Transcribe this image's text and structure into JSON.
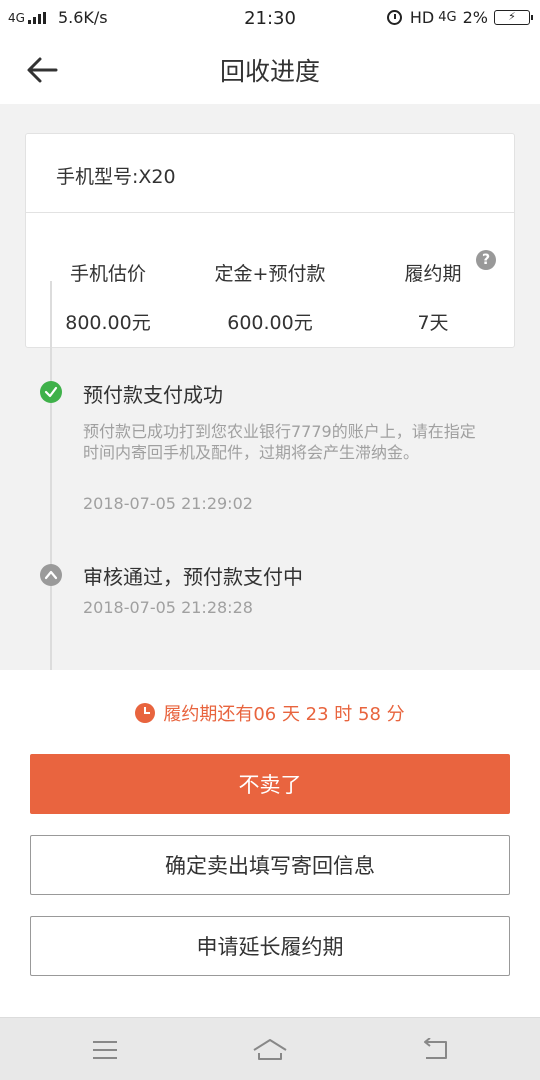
{
  "status_bar": {
    "network": "4G",
    "speed": "5.6K/s",
    "time": "21:30",
    "hd": "HD",
    "net_type": "4G",
    "battery": "2%"
  },
  "header": {
    "title": "回收进度",
    "back_icon": "arrow-left-icon"
  },
  "card": {
    "model": "手机型号:X20",
    "columns": [
      {
        "label": "手机估价",
        "value": "800.00元"
      },
      {
        "label": "定金+预付款",
        "value": "600.00元"
      },
      {
        "label": "履约期",
        "value": "7天"
      }
    ],
    "help_icon": "?"
  },
  "timeline": [
    {
      "status": "success",
      "icon": "check-icon",
      "title": "预付款支付成功",
      "desc": "预付款已成功打到您农业银行7779的账户上，请在指定时间内寄回手机及配件，过期将会产生滞纳金。",
      "time": "2018-07-05 21:29:02"
    },
    {
      "status": "pending",
      "icon": "chevron-up-icon",
      "title": "审核通过，预付款支付中",
      "time": "2018-07-05 21:28:28"
    }
  ],
  "countdown": {
    "text": "履约期还有06 天 23 时 58 分",
    "color": "#e8643e"
  },
  "buttons": {
    "cancel": "不卖了",
    "confirm": "确定卖出填写寄回信息",
    "extend": "申请延长履约期"
  },
  "colors": {
    "accent": "#e9643f",
    "success": "#3fb14a",
    "pending": "#9a9a9a"
  },
  "nav": {
    "menu_icon": "menu-icon",
    "home_icon": "home-icon",
    "back_icon": "back-icon"
  }
}
